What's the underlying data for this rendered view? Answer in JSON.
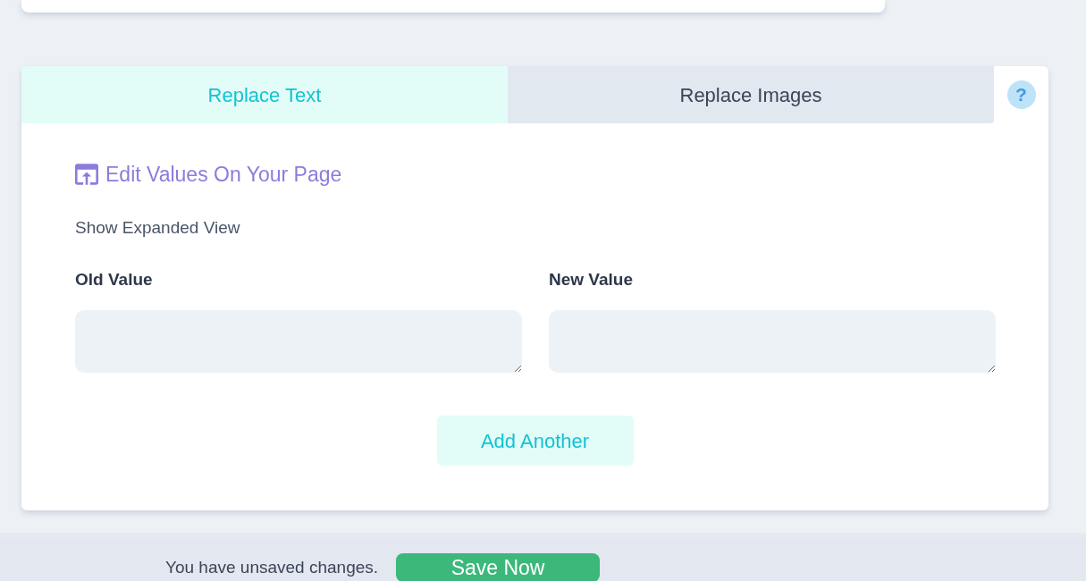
{
  "tabs": [
    {
      "label": "Replace Text",
      "selected": true
    },
    {
      "label": "Replace Images",
      "selected": false
    }
  ],
  "help_button": {
    "label": "?"
  },
  "edit_link": {
    "label": "Edit Values On Your Page"
  },
  "expand_toggle": {
    "label": "Show Expanded View"
  },
  "fields": [
    {
      "label": "Old Value"
    },
    {
      "label": "New Value"
    }
  ],
  "add_button": {
    "label": "Add Another"
  },
  "save_bar": {
    "message": "You have unsaved changes.",
    "button": "Save Now"
  }
}
